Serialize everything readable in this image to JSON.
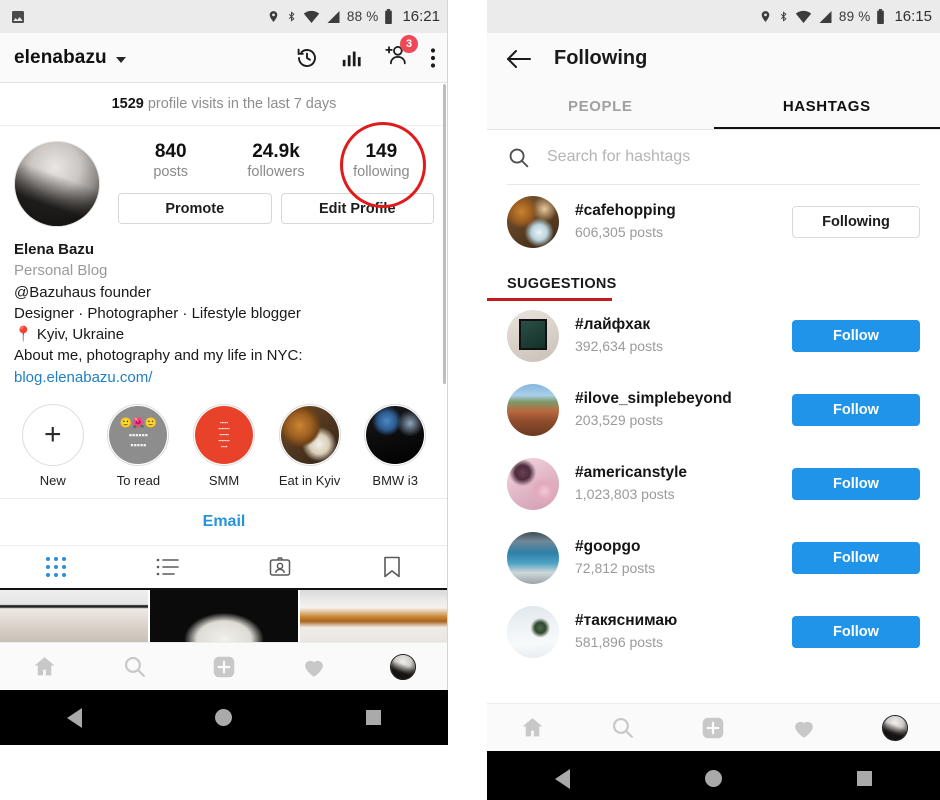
{
  "left": {
    "status_bar": {
      "left_icons": [
        "image-icon"
      ],
      "right_icons": [
        "location-icon",
        "bluetooth-icon",
        "wifi-icon",
        "signal-icon"
      ],
      "battery": "88 %",
      "clock": "16:21"
    },
    "topbar": {
      "username": "elenabazu",
      "icons": [
        "history-icon",
        "insights-bar-chart-icon",
        "add-person-icon",
        "overflow-menu-icon"
      ],
      "notification_badge": "3"
    },
    "insights_strip": {
      "count": "1529",
      "text": "profile visits in the last 7 days"
    },
    "stats": [
      {
        "num": "840",
        "label": "posts"
      },
      {
        "num": "24.9k",
        "label": "followers"
      },
      {
        "num": "149",
        "label": "following"
      }
    ],
    "buttons": {
      "promote": "Promote",
      "edit_profile": "Edit Profile"
    },
    "bio": {
      "name": "Elena Bazu",
      "category": "Personal Blog",
      "line1": "@Bazuhaus founder",
      "line2": "Designer · Photographer · Lifestyle blogger",
      "location": "Kyiv, Ukraine",
      "line3": "About me, photography and my life in NYC:",
      "link": "blog.elenabazu.com/"
    },
    "highlights": [
      {
        "label": "New",
        "type": "add"
      },
      {
        "label": "To read",
        "type": "image"
      },
      {
        "label": "SMM",
        "type": "image"
      },
      {
        "label": "Eat in Kyiv",
        "type": "image"
      },
      {
        "label": "BMW i3",
        "type": "image"
      }
    ],
    "email_button": "Email",
    "content_tabs": [
      {
        "name": "grid-tab",
        "active": true
      },
      {
        "name": "list-tab",
        "active": false
      },
      {
        "name": "tagged-tab",
        "active": false
      },
      {
        "name": "saved-tab",
        "active": false
      }
    ],
    "bottom_nav": [
      "home-icon",
      "search-icon",
      "add-post-icon",
      "activity-heart-icon",
      "profile-avatar"
    ],
    "annotation": {
      "color": "#e01b1b",
      "target": "following-stat"
    }
  },
  "right": {
    "status_bar": {
      "right_icons": [
        "location-icon",
        "bluetooth-icon",
        "wifi-icon",
        "signal-icon"
      ],
      "battery": "89 %",
      "clock": "16:15"
    },
    "topbar": {
      "back_icon": "back-arrow-icon",
      "title": "Following"
    },
    "tabs": [
      {
        "label": "PEOPLE",
        "active": false
      },
      {
        "label": "HASHTAGS",
        "active": true
      }
    ],
    "search": {
      "placeholder": "Search for hashtags",
      "value": ""
    },
    "followed": [
      {
        "tag": "#cafehopping",
        "posts": "606,305 posts",
        "action": "Following",
        "state": "following"
      }
    ],
    "suggestions_header": "SUGGESTIONS",
    "suggestions": [
      {
        "tag": "#лайфхак",
        "posts": "392,634 posts",
        "action": "Follow",
        "state": "follow"
      },
      {
        "tag": "#ilove_simplebeyond",
        "posts": "203,529 posts",
        "action": "Follow",
        "state": "follow"
      },
      {
        "tag": "#americanstyle",
        "posts": "1,023,803 posts",
        "action": "Follow",
        "state": "follow"
      },
      {
        "tag": "#goopgo",
        "posts": "72,812 posts",
        "action": "Follow",
        "state": "follow"
      },
      {
        "tag": "#такяснимаю",
        "posts": "581,896 posts",
        "action": "Follow",
        "state": "follow"
      }
    ],
    "bottom_nav": [
      "home-icon",
      "search-icon",
      "add-post-icon",
      "activity-heart-icon",
      "profile-avatar"
    ],
    "annotation": {
      "color": "#c11b1b",
      "target": "suggestions-header"
    }
  },
  "system_nav": [
    "back-triangle-icon",
    "home-circle-icon",
    "recents-square-icon"
  ],
  "colors": {
    "accent_blue": "#1f94e8",
    "link_blue": "#2494dd",
    "annotation_red": "#e01b1b",
    "badge_red": "#ed4956"
  }
}
